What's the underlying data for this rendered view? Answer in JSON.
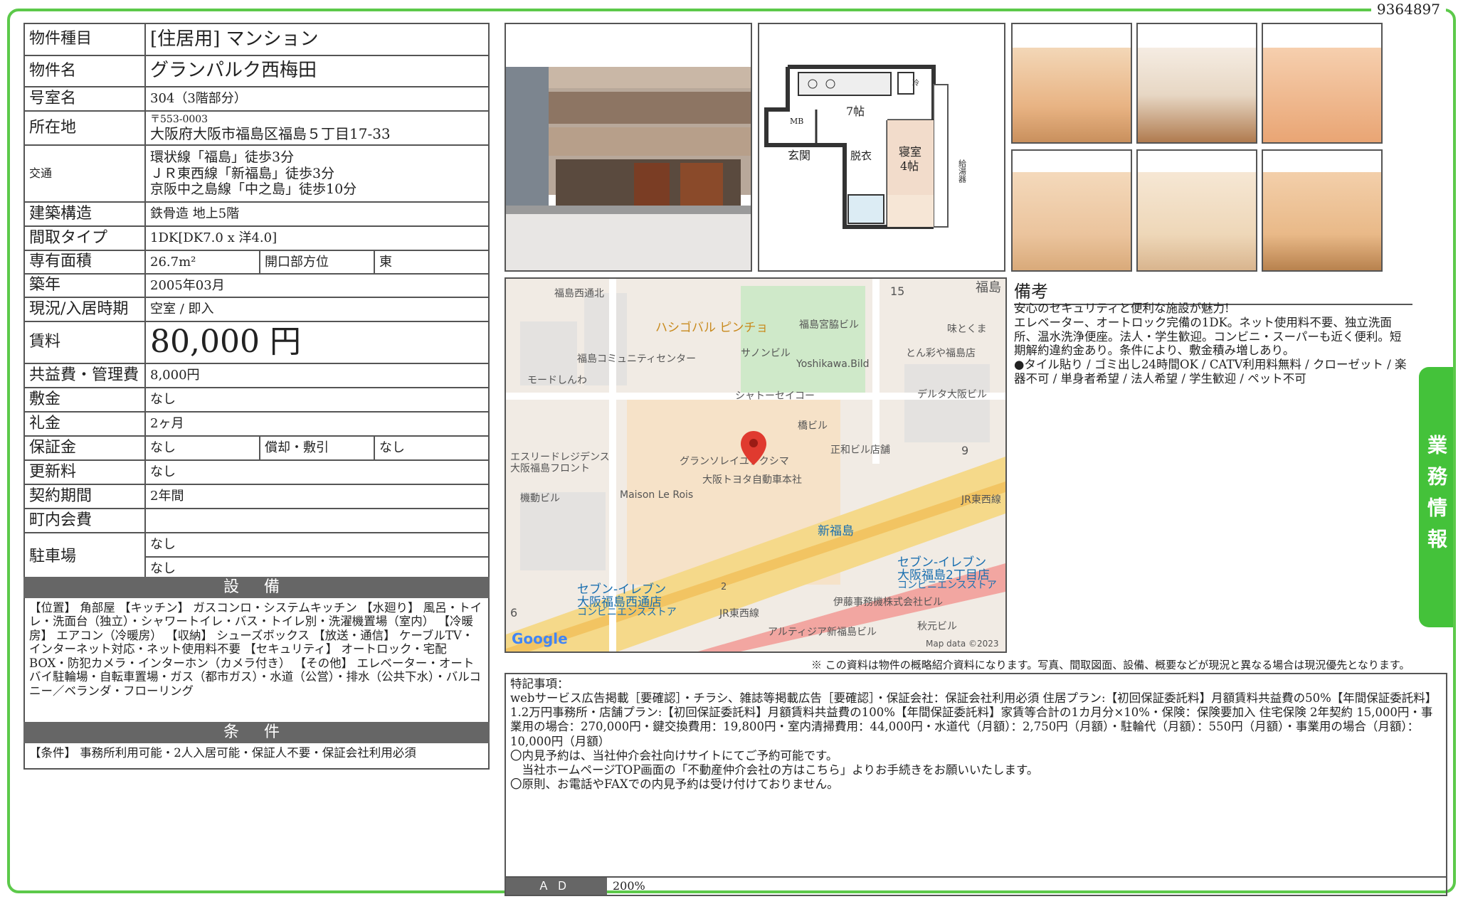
{
  "doc_id": "9364897",
  "property": {
    "type_label": "物件種目",
    "type_value": "[住居用] マンション",
    "name_label": "物件名",
    "name_value": "グランパルク西梅田",
    "room_label": "号室名",
    "room_value": "304（3階部分）",
    "address_label": "所在地",
    "address_zip": "〒553-0003",
    "address_value": "大阪府大阪市福島区福島５丁目17-33",
    "access_label": "交通",
    "access_lines": [
      "環状線「福島」徒歩3分",
      "ＪＲ東西線「新福島」徒歩3分",
      "京阪中之島線「中之島」徒歩10分"
    ],
    "structure_label": "建築構造",
    "structure_value": "鉄骨造 地上5階",
    "layout_label": "間取タイプ",
    "layout_value": "1DK[DK7.0 x 洋4.0]",
    "area_label": "専有面積",
    "area_value": "26.7m²",
    "direction_label": "開口部方位",
    "direction_value": "東",
    "built_label": "築年",
    "built_value": "2005年03月",
    "status_label": "現況/入居時期",
    "status_value": "空室 / 即入",
    "rent_label": "賃料",
    "rent_value": "80,000 円",
    "fee_label": "共益費・管理費",
    "fee_value": "8,000円",
    "deposit_label": "敷金",
    "deposit_value": "なし",
    "key_money_label": "礼金",
    "key_money_value": "2ヶ月",
    "guarantee_label": "保証金",
    "guarantee_value": "なし",
    "amortization_label": "償却・敷引",
    "amortization_value": "なし",
    "renewal_label": "更新料",
    "renewal_value": "なし",
    "contract_label": "契約期間",
    "contract_value": "2年間",
    "town_fee_label": "町内会費",
    "town_fee_value": "",
    "parking_label": "駐車場",
    "parking_values": [
      "なし",
      "なし"
    ]
  },
  "equipment": {
    "heading": "設 備",
    "text": "【位置】 角部屋 【キッチン】 ガスコンロ・システムキッチン 【水廻り】 風呂・トイレ・洗面台（独立）・シャワートイレ・バス・トイレ別・洗濯機置場（室内） 【冷暖房】 エアコン（冷暖房） 【収納】 シューズボックス 【放送・通信】 ケーブルTV・インターネット対応・ネット使用料不要 【セキュリティ】 オートロック・宅配BOX・防犯カメラ・インターホン（カメラ付き） 【その他】 エレベーター・オートバイ駐輪場・自転車置場・ガス（都市ガス）・水道（公営）・排水（公共下水）・バルコニー／ベランダ・フローリング"
  },
  "conditions": {
    "heading": "条 件",
    "text": "【条件】 事務所利用可能・2人入居可能・保証人不要・保証会社利用必須"
  },
  "floorplan": {
    "kitchen": "7帖",
    "bedroom": "寝室",
    "bedroom_size": "4帖",
    "entrance": "玄関",
    "dressing": "脱衣",
    "mb": "MB",
    "heater": "給湯器",
    "fridge": "冷"
  },
  "map": {
    "labels": [
      "福島西通北",
      "ハシゴバル ピンチョ",
      "福島宮脇ビル",
      "味とくま",
      "サノンビル",
      "Yoshikawa.Bild",
      "福島コミュニティセンター",
      "とん彩や福島店",
      "モードしんわ",
      "シャトーセイコー",
      "デルタ大阪ビル",
      "橋ビル",
      "エスリードレジデンス",
      "大阪福島フロント",
      "グランソレイユフクシマ",
      "正和ビル店舗",
      "大阪トヨタ自動車本社",
      "機動ビル",
      "Maison Le Rois",
      "新福島",
      "JR東西線",
      "セブン-イレブン",
      "大阪福島2丁目店",
      "コンビニエンスストア",
      "セブン-イレブン",
      "大阪福島西通店",
      "コンビニエンスストア",
      "伊藤事務機株式会社ビル",
      "JR東西線",
      "秋元ビル",
      "アルティジア新福島ビル",
      "Google",
      "Map data ©2023",
      "15",
      "9",
      "6",
      "2",
      "福島"
    ]
  },
  "remarks": {
    "title": "備考",
    "lines": [
      "安心のセキュリティと便利な施設が魅力!",
      "エレベーター、オートロック完備の1DK。ネット使用料不要、独立洗面所、温水洗浄便座。法人・学生歓迎。コンビニ・スーパーも近く便利。短期解約違約金あり。条件により、敷金積み増しあり。",
      "●タイル貼り / ゴミ出し24時間OK / CATV利用料無料 / クローゼット / 楽器不可 / 単身者希望 / 法人希望 / 学生歓迎 / ペット不可"
    ]
  },
  "side_tab": "業務情報",
  "disclaimer": "※ この資料は物件の概略紹介資料になります。写真、間取図面、設備、概要などが現況と異なる場合は現況優先となります。",
  "notes": {
    "title": "特記事項：",
    "lines": [
      "webサービス広告掲載［要確認］・チラシ、雑誌等掲載広告［要確認］・保証会社：保証会社利用必須 住居プラン:【初回保証委託料】月額賃料共益費の50%【年間保証委託料】1.2万円事務所・店舗プラン:【初回保証委託料】月額賃料共益費の100%【年間保証委託料】家賃等合計の1カ月分×10%・保険：保険要加入 住宅保険 2年契約 15,000円・事業用の場合：270,000円・鍵交換費用：19,800円・室内清掃費用：44,000円・水道代（月額）：2,750円（月額）・駐輪代（月額）：550円（月額）・事業用の場合（月額）：10,000円（月額）",
      "〇内見予約は、当社仲介会社向けサイトにてご予約可能です。",
      "　当社ホームページTOP画面の「不動産仲介会社の方はこちら」よりお手続きをお願いいたします。",
      "〇原則、お電話やFAXでの内見予約は受け付けておりません。"
    ]
  },
  "ad": {
    "label": "ＡＤ",
    "value": "200%"
  },
  "colors": {
    "frame": "#5cc94a",
    "tab": "#44c23a",
    "header_bg": "#666666",
    "map_pin": "#e03a2f"
  }
}
